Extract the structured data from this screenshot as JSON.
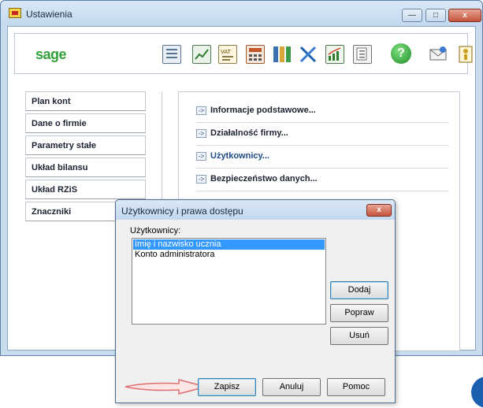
{
  "window": {
    "title": "Ustawienia",
    "controls": {
      "minimize": "—",
      "maximize": "□",
      "close": "x"
    }
  },
  "toolbar": {
    "logo": "sage",
    "icons": [
      "ledger-icon",
      "chart-icon",
      "vat-icon",
      "calculator-icon",
      "binders-icon",
      "tools-icon",
      "trend-chart-icon",
      "documents-icon",
      "help-icon",
      "mail-icon",
      "info-icon"
    ],
    "help_glyph": "?"
  },
  "left_menu": {
    "items": [
      {
        "label": "Plan kont"
      },
      {
        "label": "Dane o firmie"
      },
      {
        "label": "Parametry stałe"
      },
      {
        "label": "Układ bilansu"
      },
      {
        "label": "Układ RZiS"
      },
      {
        "label": "Znaczniki"
      }
    ]
  },
  "right_panel": {
    "links": [
      {
        "label": "Informacje podstawowe...",
        "active": false
      },
      {
        "label": "Działalność firmy...",
        "active": false
      },
      {
        "label": "Użytkownicy...",
        "active": true
      },
      {
        "label": "Bezpieczeństwo danych...",
        "active": false
      }
    ],
    "arrow_glyph": "->"
  },
  "dialog": {
    "title": "Użytkownicy i prawa dostępu",
    "close_glyph": "x",
    "users_label": "Użytkownicy:",
    "users": [
      {
        "name": "Imię i nazwisko ucznia",
        "selected": true
      },
      {
        "name": "Konto administratora",
        "selected": false
      }
    ],
    "buttons": {
      "add": "Dodaj",
      "edit": "Popraw",
      "delete": "Usuń",
      "save": "Zapisz",
      "cancel": "Anuluj",
      "help": "Pomoc"
    }
  },
  "colors": {
    "accent": "#1d4a8a",
    "selection": "#3399ff",
    "sage_green": "#33a03a",
    "annotation_arrow": "#e07070"
  }
}
